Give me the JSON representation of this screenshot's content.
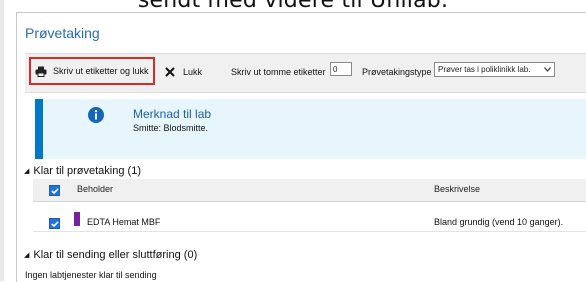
{
  "caption": "sendt med videre til Unilab.",
  "window": {
    "title": "Prøvetaking"
  },
  "toolbar": {
    "print_label": "Skriv ut etiketter og lukk",
    "close_label": "Lukk",
    "empty_labels_label": "Skriv ut tomme etiketter",
    "empty_labels_value": "0",
    "sampletype_label": "Prøvetakingstype",
    "sampletype_value": "Prøver tas i poliklinikk lab.",
    "icons": {
      "print": "printer-icon",
      "close": "close-icon",
      "dropdown": "chevron-down-icon"
    }
  },
  "notice": {
    "icon": "info-icon",
    "title": "Merknad til lab",
    "text": "Smitte: Blodsmitte.",
    "accent_color": "#0078c8"
  },
  "section_ready": {
    "title": "Klar til prøvetaking (1)",
    "columns": [
      "Beholder",
      "Beskrivelse"
    ],
    "rows": [
      {
        "checked": true,
        "container": "EDTA Hemat MBF",
        "description": "Bland grundig (vend 10 ganger).",
        "color": "#7b1fa2"
      }
    ]
  },
  "section_send": {
    "title": "Klar til sending eller sluttføring (0)",
    "empty_text": "Ingen labtjenester klar til sending"
  },
  "colors": {
    "highlight_border": "#d62b2b",
    "checkbox": "#1e73d8",
    "title": "#2b6cb0"
  }
}
